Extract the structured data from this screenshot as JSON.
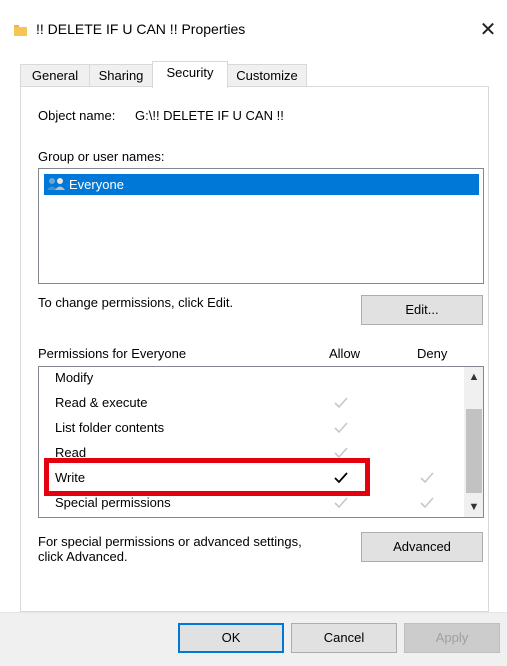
{
  "window": {
    "title": "!! DELETE IF U CAN !! Properties",
    "close_glyph": "✕",
    "icon": "folder-icon"
  },
  "tabs": [
    {
      "label": "General"
    },
    {
      "label": "Sharing"
    },
    {
      "label": "Security"
    },
    {
      "label": "Customize"
    }
  ],
  "active_tab": "Security",
  "security": {
    "object_name_label": "Object name:",
    "object_name_value": "G:\\!! DELETE IF U CAN !!",
    "group_label": "Group or user names:",
    "users": [
      {
        "name": "Everyone",
        "icon": "users-icon",
        "selected": true
      }
    ],
    "change_hint": "To change permissions, click Edit.",
    "edit_label": "Edit...",
    "permissions_header": "Permissions for Everyone",
    "allow_header": "Allow",
    "deny_header": "Deny",
    "permissions": [
      {
        "name": "Modify",
        "allow": "none",
        "deny": "none"
      },
      {
        "name": "Read & execute",
        "allow": "inherited",
        "deny": "none"
      },
      {
        "name": "List folder contents",
        "allow": "inherited",
        "deny": "none"
      },
      {
        "name": "Read",
        "allow": "inherited",
        "deny": "none"
      },
      {
        "name": "Write",
        "allow": "explicit",
        "deny": "inherited"
      },
      {
        "name": "Special permissions",
        "allow": "inherited",
        "deny": "inherited"
      }
    ],
    "advanced_hint_line1": "For special permissions or advanced settings,",
    "advanced_hint_line2": "click Advanced.",
    "advanced_label": "Advanced"
  },
  "footer": {
    "ok_label": "OK",
    "cancel_label": "Cancel",
    "apply_label": "Apply"
  },
  "colors": {
    "selection": "#0078d7",
    "highlight_box": "#e3000f",
    "inherited_check": "#c8c8c8",
    "explicit_check": "#000000"
  }
}
